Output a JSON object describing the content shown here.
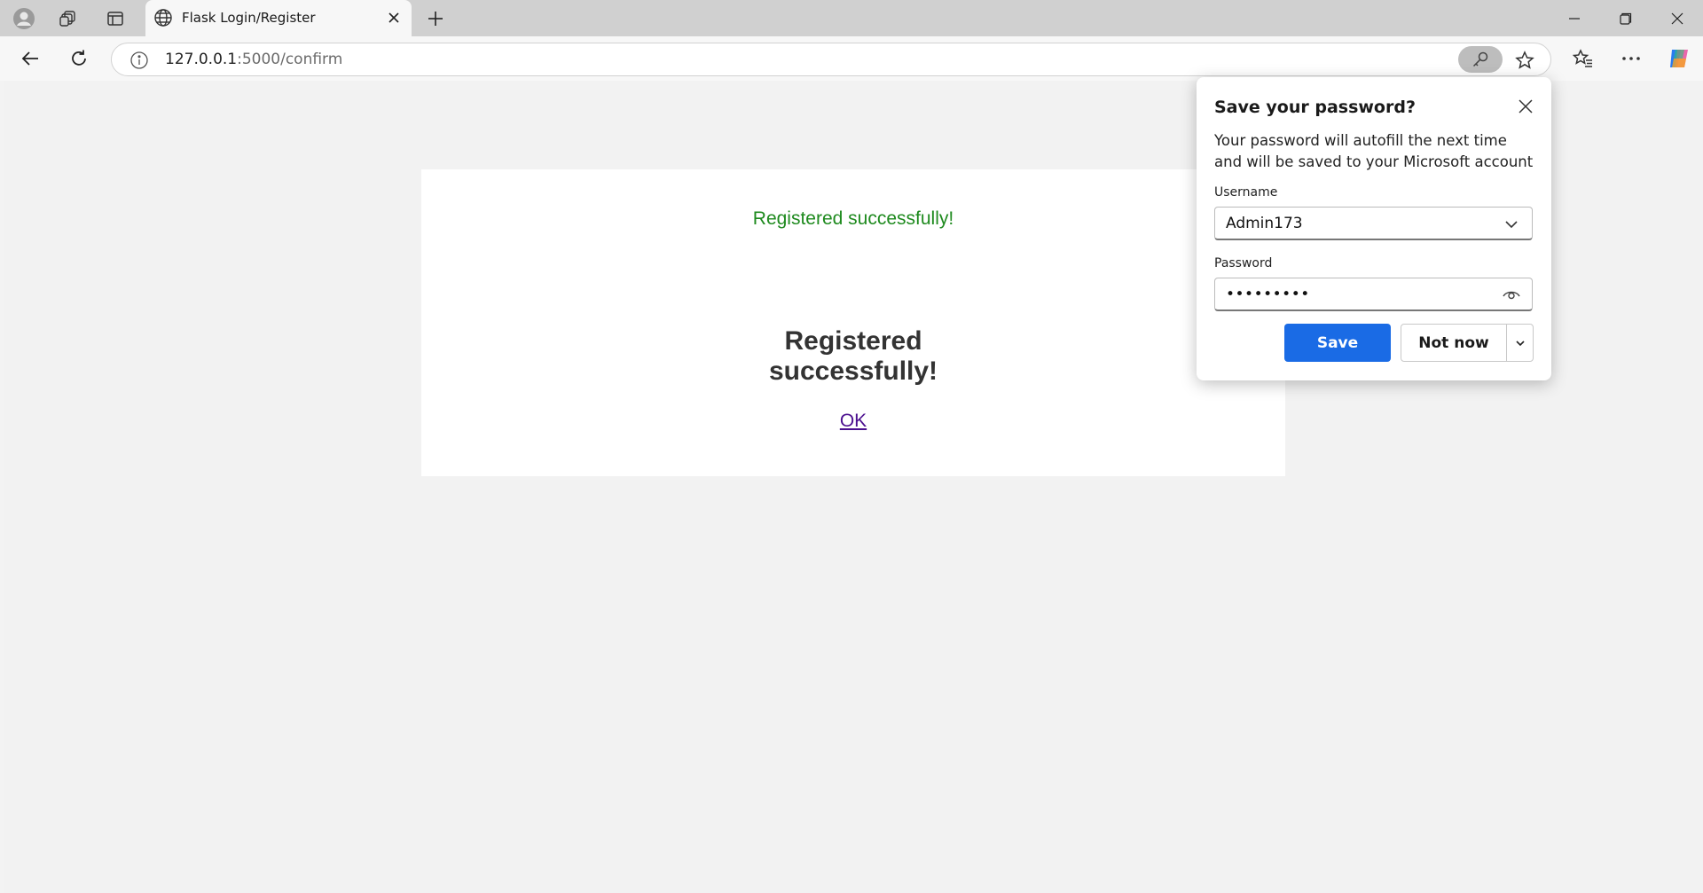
{
  "browser": {
    "tab_title": "Flask Login/Register",
    "url_host": "127.0.0.1",
    "url_rest": ":5000/confirm"
  },
  "page": {
    "flash_message": "Registered successfully!",
    "heading_line1": "Registered",
    "heading_line2": "successfully!",
    "ok_link": "OK"
  },
  "password_popup": {
    "title": "Save your password?",
    "description": "Your password will autofill the next time and will be saved to your Microsoft account",
    "username_label": "Username",
    "username_value": "Admin173",
    "password_label": "Password",
    "password_value": "•••••••••",
    "save_label": "Save",
    "not_now_label": "Not now"
  },
  "colors": {
    "flash_green": "#1e8a1e",
    "save_blue": "#1a6be5",
    "link_purple": "#4b0f8f"
  }
}
